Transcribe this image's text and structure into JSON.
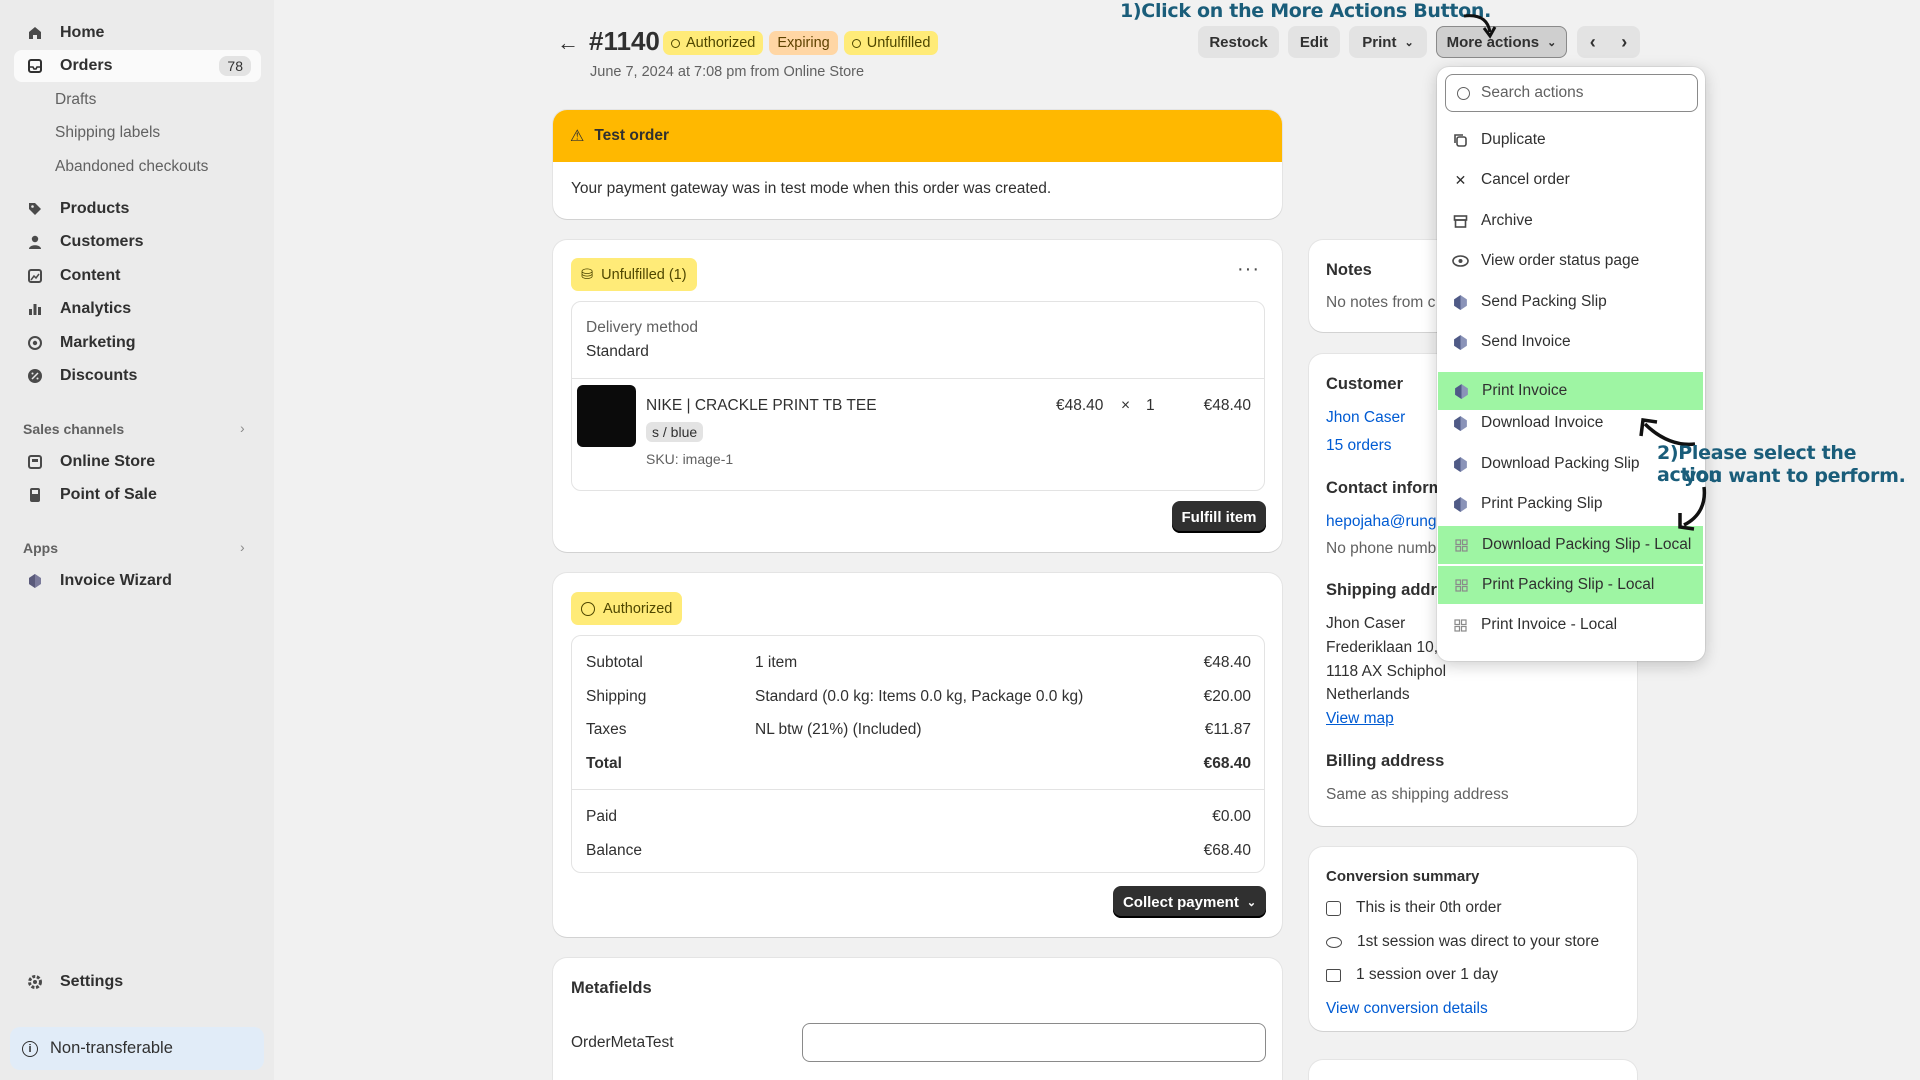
{
  "sidebar": {
    "items": [
      {
        "label": "Home",
        "icon": "home-icon"
      },
      {
        "label": "Orders",
        "icon": "orders-icon",
        "count": "78"
      },
      {
        "label": "Products",
        "icon": "tag-icon"
      },
      {
        "label": "Customers",
        "icon": "person-icon"
      },
      {
        "label": "Content",
        "icon": "image-icon"
      },
      {
        "label": "Analytics",
        "icon": "bar-chart-icon"
      },
      {
        "label": "Marketing",
        "icon": "target-icon"
      },
      {
        "label": "Discounts",
        "icon": "discount-icon"
      }
    ],
    "order_sub": [
      "Drafts",
      "Shipping labels",
      "Abandoned checkouts"
    ],
    "sales_channels_label": "Sales channels",
    "sales_channels": [
      "Online Store",
      "Point of Sale"
    ],
    "apps_label": "Apps",
    "apps": [
      "Invoice Wizard"
    ],
    "settings": "Settings",
    "footer": "Non-transferable"
  },
  "header": {
    "order_number": "#1140",
    "badges": [
      "Authorized",
      "Expiring",
      "Unfulfilled"
    ],
    "subtitle": "June 7, 2024 at 7:08 pm from Online Store",
    "buttons": {
      "restock": "Restock",
      "edit": "Edit",
      "print": "Print",
      "more": "More actions"
    }
  },
  "banner": {
    "title": "Test order",
    "text": "Your payment gateway was in test mode when this order was created."
  },
  "fulfillment": {
    "badge": "Unfulfilled (1)",
    "delivery_label": "Delivery method",
    "delivery_value": "Standard",
    "product": {
      "name": "NIKE | CRACKLE PRINT TB TEE",
      "variant": "s / blue",
      "sku": "SKU: image-1",
      "price": "€48.40",
      "times": "×",
      "qty": "1",
      "total": "€48.40"
    },
    "button": "Fulfill item"
  },
  "payment": {
    "badge": "Authorized",
    "rows": [
      {
        "label": "Subtotal",
        "desc": "1 item",
        "amount": "€48.40"
      },
      {
        "label": "Shipping",
        "desc": "Standard (0.0 kg: Items 0.0 kg, Package 0.0 kg)",
        "amount": "€20.00"
      },
      {
        "label": "Taxes",
        "desc": "NL btw (21%) (Included)",
        "amount": "€11.87"
      },
      {
        "label": "Total",
        "desc": "",
        "amount": "€68.40"
      }
    ],
    "paid_label": "Paid",
    "paid": "€0.00",
    "balance_label": "Balance",
    "balance": "€68.40",
    "button": "Collect payment"
  },
  "metafields": {
    "title": "Metafields",
    "field_label": "OrderMetaTest",
    "field_value": ""
  },
  "notes": {
    "title": "Notes",
    "text": "No notes from c"
  },
  "customer": {
    "title": "Customer",
    "name": "Jhon Caser",
    "orders": "15 orders",
    "contact_title": "Contact inform",
    "email": "hepojaha@rung",
    "phone": "No phone numb",
    "shipping_title": "Shipping addr",
    "address": [
      "Jhon Caser",
      "Frederiklaan 10,",
      "1118 AX Schiphol",
      "Netherlands"
    ],
    "view_map": "View map",
    "billing_title": "Billing address",
    "billing_text": "Same as shipping address"
  },
  "conversion": {
    "title": "Conversion summary",
    "items": [
      "This is their 0th order",
      "1st session was direct to your store",
      "1 session over 1 day"
    ],
    "link": "View conversion details"
  },
  "dropdown": {
    "search_placeholder": "Search actions",
    "items": [
      {
        "label": "Duplicate",
        "icon": "duplicate-icon"
      },
      {
        "label": "Cancel order",
        "icon": "close-icon"
      },
      {
        "label": "Archive",
        "icon": "archive-icon"
      },
      {
        "label": "View order status page",
        "icon": "eye-icon"
      },
      {
        "label": "Send Packing Slip",
        "icon": "invoice-wizard-icon"
      },
      {
        "label": "Send Invoice",
        "icon": "invoice-wizard-icon"
      },
      {
        "label": "Print Invoice",
        "icon": "invoice-wizard-icon",
        "highlight": true
      },
      {
        "label": "Download Invoice",
        "icon": "invoice-wizard-icon"
      },
      {
        "label": "Download Packing Slip",
        "icon": "invoice-wizard-icon"
      },
      {
        "label": "Print Packing Slip",
        "icon": "invoice-wizard-icon"
      },
      {
        "label": "Download Packing Slip - Local",
        "icon": "app-grid-icon",
        "highlight": true
      },
      {
        "label": "Print Packing Slip - Local",
        "icon": "app-grid-icon",
        "highlight": true
      },
      {
        "label": "Print Invoice - Local",
        "icon": "app-grid-icon"
      }
    ]
  },
  "annotations": {
    "step1": "1)Click on the More Actions Button.",
    "step2_line1": "2)Please select the action",
    "step2_line2": "you want to perform."
  },
  "colors": {
    "banner": "#ffb800",
    "highlight": "#9ef5a3",
    "annotation": "#1a5d7a",
    "link": "#005bd3"
  }
}
